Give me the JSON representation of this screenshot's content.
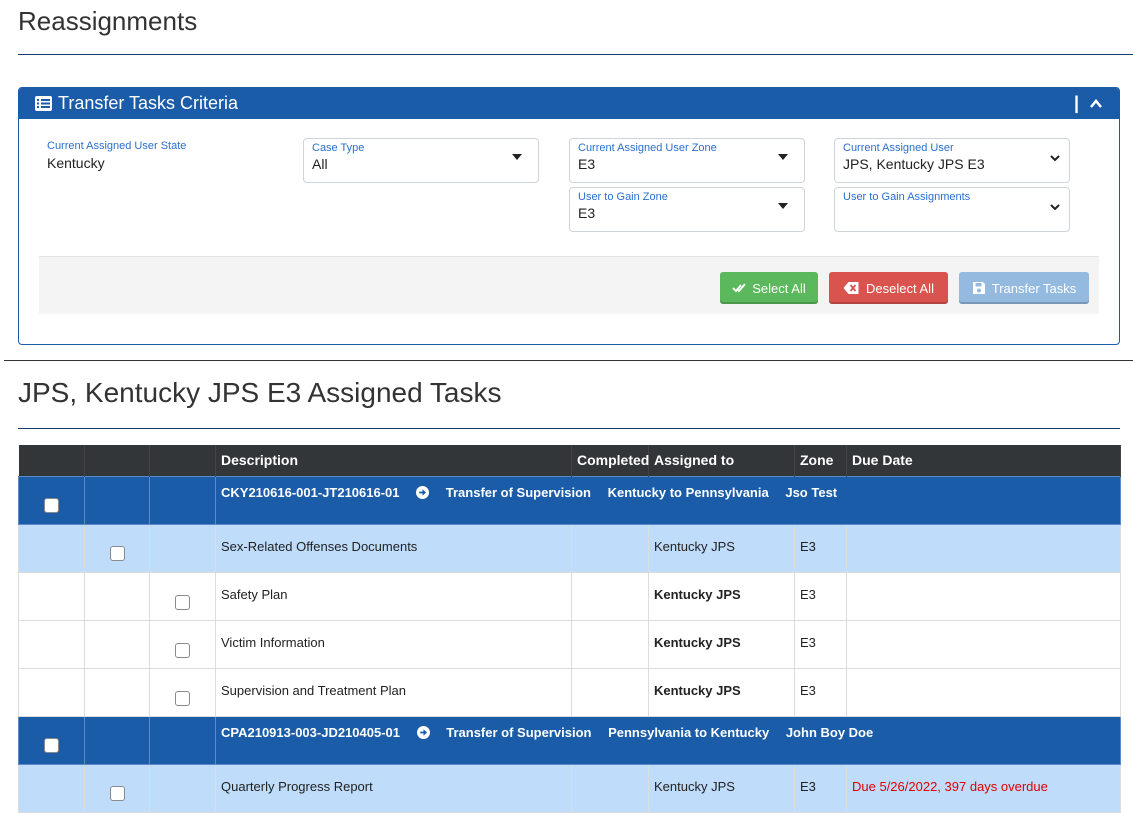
{
  "page": {
    "title": "Reassignments"
  },
  "criteria": {
    "title": "Transfer Tasks Criteria",
    "header_bar": "|",
    "state_label": "Current Assigned User State",
    "state_value": "Kentucky",
    "case_type": {
      "label": "Case Type",
      "value": "All"
    },
    "current_zone": {
      "label": "Current Assigned User Zone",
      "value": "E3"
    },
    "current_user": {
      "label": "Current Assigned User",
      "value": "JPS, Kentucky JPS E3"
    },
    "gain_zone": {
      "label": "User to Gain Zone",
      "value": "E3"
    },
    "gain_assignments": {
      "label": "User to Gain Assignments",
      "value": ""
    },
    "buttons": {
      "select_all": "Select All",
      "deselect_all": "Deselect All",
      "transfer": "Transfer Tasks"
    },
    "colors": {
      "header": "#1a5ca8",
      "select": "#5cb85c",
      "deselect": "#d9534f",
      "transfer": "#95badf"
    }
  },
  "tasks_section": {
    "title": "JPS, Kentucky JPS E3 Assigned Tasks"
  },
  "table": {
    "headers": [
      "",
      "",
      "",
      "Description",
      "Completed",
      "Assigned to",
      "Zone",
      "Due Date"
    ],
    "case1": {
      "id": "CKY210616-001-JT210616-01",
      "type": "Transfer of Supervision",
      "route": "Kentucky to Pennsylvania",
      "person": "Jso Test"
    },
    "case1_tasks": [
      {
        "description": "Sex-Related Offenses Documents",
        "completed": "",
        "assigned": "Kentucky JPS",
        "zone": "E3",
        "due": ""
      },
      {
        "description": "Safety Plan",
        "completed": "",
        "assigned": "Kentucky JPS",
        "zone": "E3",
        "due": ""
      },
      {
        "description": "Victim Information",
        "completed": "",
        "assigned": "Kentucky JPS",
        "zone": "E3",
        "due": ""
      },
      {
        "description": "Supervision and Treatment Plan",
        "completed": "",
        "assigned": "Kentucky JPS",
        "zone": "E3",
        "due": ""
      }
    ],
    "case2": {
      "id": "CPA210913-003-JD210405-01",
      "type": "Transfer of Supervision",
      "route": "Pennsylvania to Kentucky",
      "person": "John Boy Doe"
    },
    "case2_tasks": [
      {
        "description": "Quarterly Progress Report",
        "completed": "",
        "assigned": "Kentucky JPS",
        "zone": "E3",
        "due": "Due 5/26/2022, 397 days overdue"
      }
    ]
  }
}
